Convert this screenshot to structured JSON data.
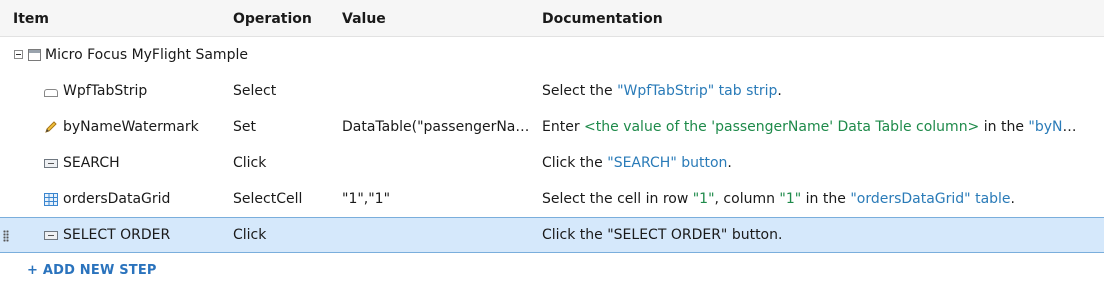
{
  "columns": {
    "item": "Item",
    "operation": "Operation",
    "value": "Value",
    "documentation": "Documentation"
  },
  "root": {
    "label": "Micro Focus MyFlight Sample",
    "icon": "window-icon"
  },
  "steps": [
    {
      "item": "WpfTabStrip",
      "icon": "tab-strip-icon",
      "operation": "Select",
      "value": "",
      "doc": {
        "pre": "Select the ",
        "ident": "\"WpfTabStrip\" tab strip",
        "post": "."
      }
    },
    {
      "item": "byNameWatermark",
      "icon": "pencil-icon",
      "operation": "Set",
      "value": "DataTable(\"passengerNam…",
      "doc": {
        "pre": "Enter ",
        "param": "<the value of the 'passengerName' Data Table column>",
        "mid": " in the ",
        "ident": "\"byNa…"
      }
    },
    {
      "item": "SEARCH",
      "icon": "button-icon",
      "operation": "Click",
      "value": "",
      "doc": {
        "pre": "Click the ",
        "ident": "\"SEARCH\" button",
        "post": "."
      }
    },
    {
      "item": "ordersDataGrid",
      "icon": "grid-icon",
      "operation": "SelectCell",
      "value": "\"1\",\"1\"",
      "doc": {
        "pre": "Select the cell in row ",
        "num1": "\"1\"",
        "mid": ", column ",
        "num2": "\"1\"",
        "mid2": " in the ",
        "ident": "\"ordersDataGrid\" table",
        "post": "."
      }
    },
    {
      "item": "SELECT ORDER",
      "icon": "button-icon",
      "operation": "Click",
      "value": "",
      "doc": {
        "pre": "Click the \"SELECT ORDER\" button."
      }
    }
  ],
  "add_step_label": "+ ADD NEW STEP",
  "colors": {
    "accent": "#2a73bd",
    "identifier": "#2a7bb8",
    "parameter": "#1e8a4a",
    "selected_row": "#d5e8fb"
  }
}
